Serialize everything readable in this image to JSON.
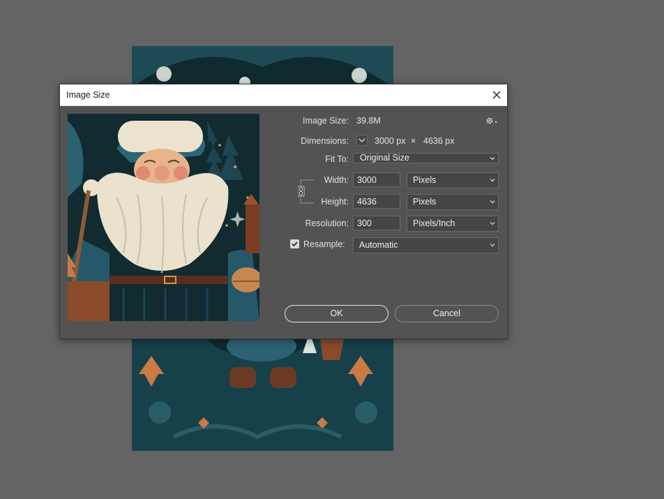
{
  "dialog": {
    "title": "Image Size",
    "close_icon": "close-icon"
  },
  "image_size": {
    "label": "Image Size:",
    "value": "39.8M"
  },
  "dimensions": {
    "label": "Dimensions:",
    "width": "3000 px",
    "separator": "×",
    "height": "4636 px"
  },
  "fit_to": {
    "label": "Fit To:",
    "selected": "Original Size"
  },
  "width": {
    "label": "Width:",
    "value": "3000",
    "unit": "Pixels"
  },
  "height": {
    "label": "Height:",
    "value": "4636",
    "unit": "Pixels"
  },
  "resolution": {
    "label": "Resolution:",
    "value": "300",
    "unit": "Pixels/Inch"
  },
  "resample": {
    "label": "Resample:",
    "checked": true,
    "selected": "Automatic"
  },
  "buttons": {
    "ok": "OK",
    "cancel": "Cancel"
  },
  "colors": {
    "dialog_bg": "#535353",
    "workspace_bg": "#646464",
    "field_bg": "#454545",
    "artwork_teal": "#1f4e59",
    "artwork_cream": "#efe6d2",
    "artwork_copper": "#b8683a"
  }
}
